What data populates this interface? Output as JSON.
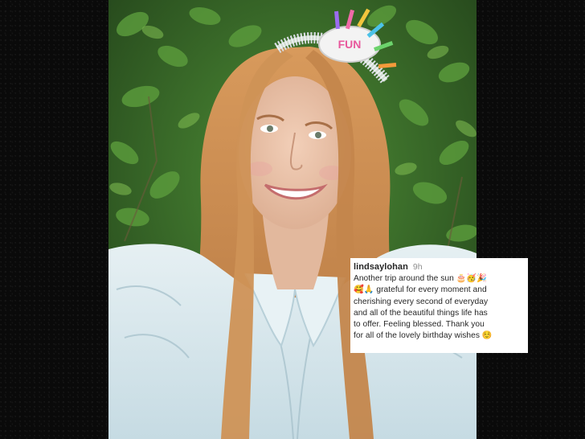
{
  "post": {
    "username": "lindsaylohan",
    "time_ago": "9h",
    "caption_lines": [
      "Another trip around the sun 🎂🥳🎉",
      "🥰🙏 grateful for every moment and",
      "cherishing every second of everyday",
      "and all of the beautiful things life has",
      "to offer. Feeling blessed. Thank you",
      "for all of the lovely birthday wishes ☺️"
    ]
  },
  "photo": {
    "headband_text": "FUN",
    "colors": {
      "leaves": "#3f7a2c",
      "hair": "#c98a4e",
      "skin": "#e9c2a8",
      "blouse": "#d9e8ee"
    }
  }
}
